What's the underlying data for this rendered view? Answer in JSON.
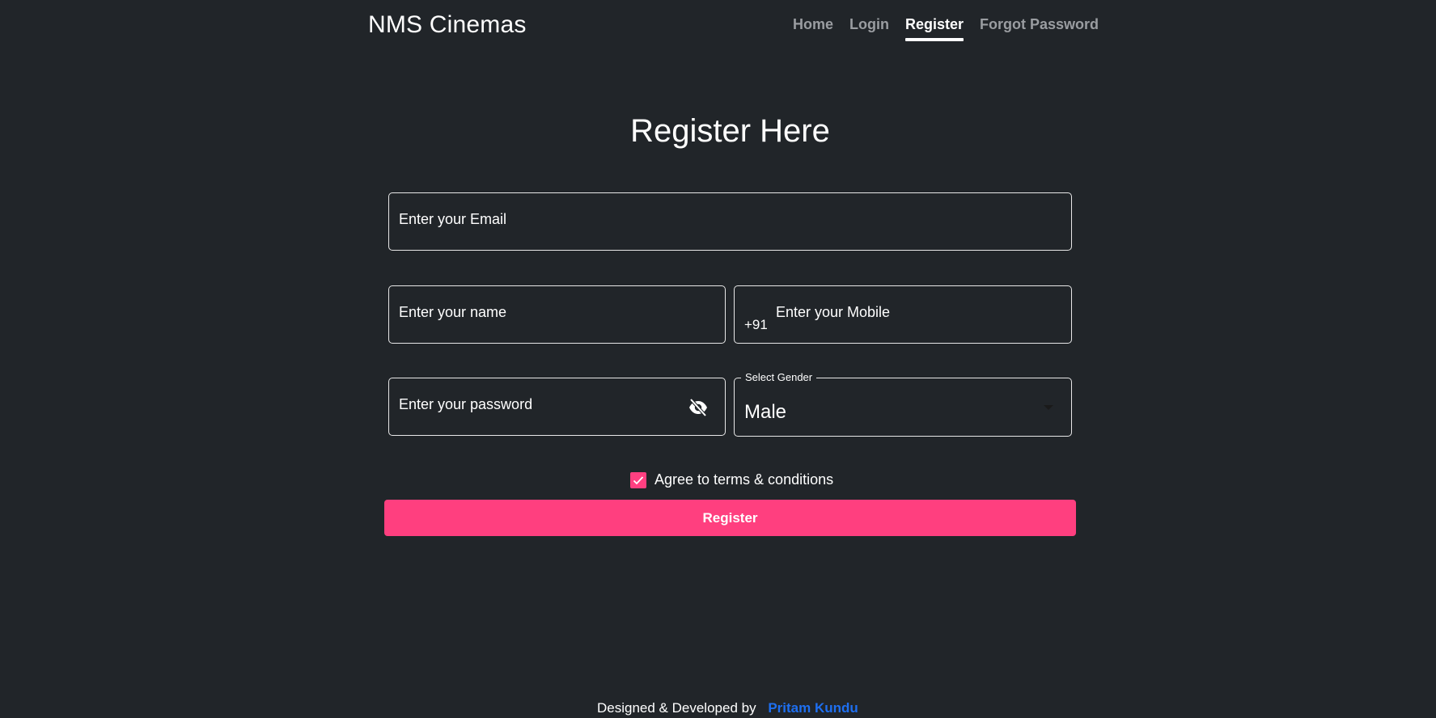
{
  "brand": "NMS Cinemas",
  "nav": {
    "home": "Home",
    "login": "Login",
    "register": "Register",
    "forgot": "Forgot Password"
  },
  "form": {
    "title": "Register Here",
    "email_placeholder": "Enter your Email",
    "name_placeholder": "Enter your name",
    "mobile_prefix": "+91",
    "mobile_placeholder": "Enter your Mobile",
    "password_placeholder": "Enter your password",
    "gender_label": "Select Gender",
    "gender_value": "Male",
    "agree_label": "Agree to terms & conditions",
    "agree_checked": true,
    "submit_label": "Register"
  },
  "footer": {
    "text": "Designed & Developed by",
    "author": "Pritam Kundu"
  },
  "colors": {
    "background": "#212529",
    "accent": "#ff3f7f",
    "link": "#1e6ff0"
  },
  "icons": {
    "password_toggle": "eye-slash-icon",
    "gender_dropdown": "chevron-down-icon",
    "checkbox": "check-icon"
  }
}
